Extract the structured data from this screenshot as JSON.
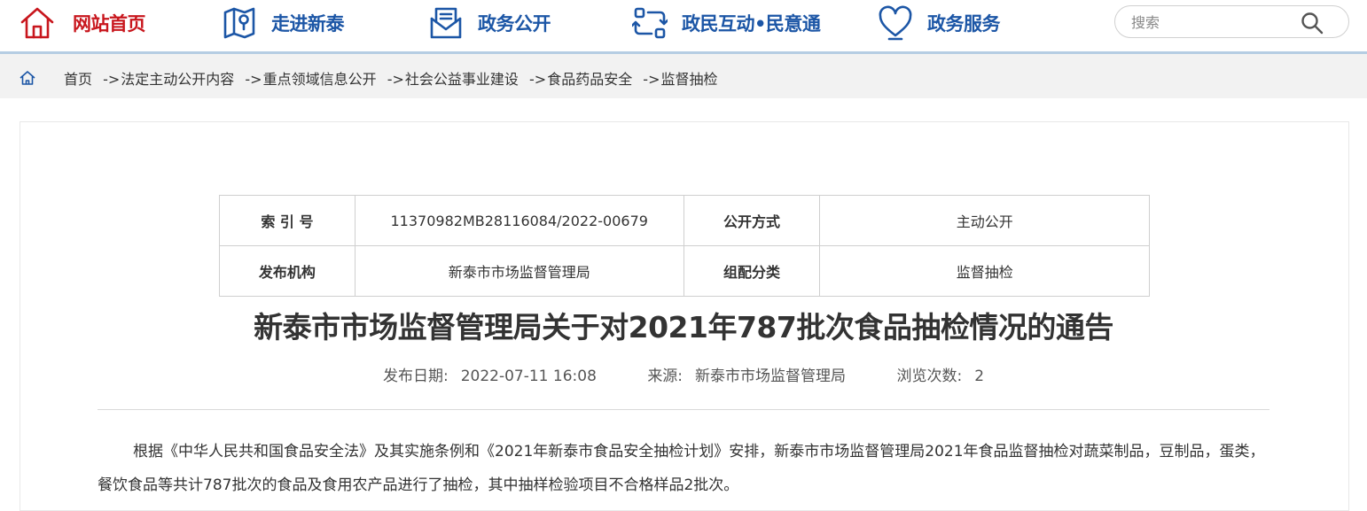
{
  "nav": {
    "home": {
      "label": "网站首页",
      "icon": "home-icon"
    },
    "intro": {
      "label": "走进新泰",
      "icon": "map-icon"
    },
    "gov": {
      "label": "政务公开",
      "icon": "envelope-icon"
    },
    "interact": {
      "label": "政民互动•民意通",
      "icon": "exchange-icon"
    },
    "service": {
      "label": "政务服务",
      "icon": "heart-icon"
    }
  },
  "search": {
    "placeholder": "搜索",
    "value": ""
  },
  "breadcrumb": {
    "items": [
      "首页",
      "法定主动公开内容",
      "重点领域信息公开",
      "社会公益事业建设",
      "食品药品安全",
      "监督抽检"
    ],
    "separator": "->"
  },
  "meta": {
    "index_label": "索 引 号",
    "index_value": "11370982MB28116084/2022-00679",
    "method_label": "公开方式",
    "method_value": "主动公开",
    "publisher_label": "发布机构",
    "publisher_value": "新泰市市场监督管理局",
    "category_label": "组配分类",
    "category_value": "监督抽检"
  },
  "article": {
    "title": "新泰市市场监督管理局关于对2021年787批次食品抽检情况的通告",
    "date_label": "发布日期:",
    "date_value": "2022-07-11 16:08",
    "source_label": "来源:",
    "source_value": "新泰市市场监督管理局",
    "views_label": "浏览次数:",
    "views_value": "2",
    "body": "根据《中华人民共和国食品安全法》及其实施条例和《2021年新泰市食品安全抽检计划》安排，新泰市市场监督管理局2021年食品监督抽检对蔬菜制品，豆制品，蛋类，餐饮食品等共计787批次的食品及食用农产品进行了抽检，其中抽样检验项目不合格样品2批次。"
  },
  "colors": {
    "brand_red": "#c8161d",
    "nav_blue": "#1c56a6",
    "crumb_bg": "#f2f2f2"
  }
}
